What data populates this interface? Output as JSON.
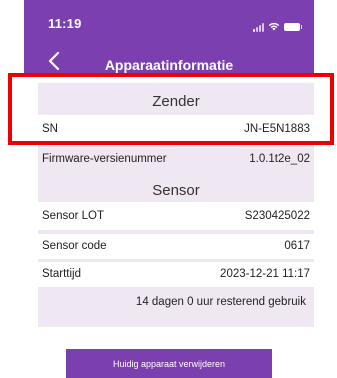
{
  "status_bar": {
    "time": "11:19",
    "signal_icon": "signal-bars-icon",
    "wifi_icon": "wifi-icon",
    "battery_icon": "battery-icon"
  },
  "header": {
    "back_icon": "chevron-left-icon",
    "title": "Apparaatinformatie"
  },
  "transmitter": {
    "section_title": "Zender",
    "sn_label": "SN",
    "sn_value": "JN-E5N1883",
    "firmware_label": "Firmware-versienummer",
    "firmware_value": "1.0.1t2e_02"
  },
  "sensor": {
    "section_title": "Sensor",
    "lot_label": "Sensor LOT",
    "lot_value": "S230425022",
    "code_label": "Sensor code",
    "code_value": "0617",
    "start_label": "Starttijd",
    "start_value": "2023-12-21 11:17",
    "remaining_text": "14 dagen 0 uur resterend gebruik"
  },
  "actions": {
    "remove_button": "Huidig apparaat verwijderen"
  },
  "colors": {
    "header_purple": "#7b3fb0",
    "card_background": "#efe8f3",
    "highlight_red": "#ee0000"
  }
}
